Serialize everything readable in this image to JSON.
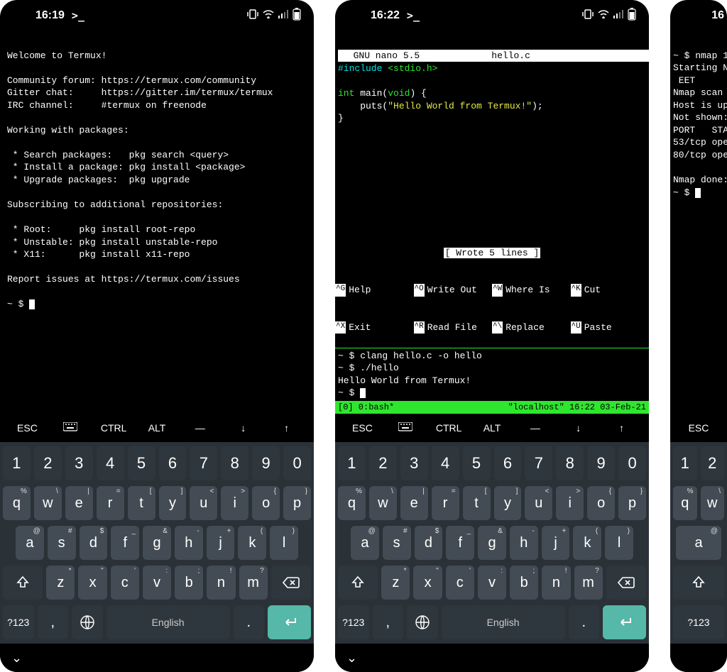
{
  "status": {
    "t1": "16:19",
    "t2": "16:22",
    "t3": "16",
    "prompt": ">_"
  },
  "p1": {
    "welcome": "Welcome to Termux!",
    "forum_label": "Community forum:",
    "forum_url": "https://termux.com/community",
    "gitter_label": "Gitter chat:",
    "gitter_url": "https://gitter.im/termux/termux",
    "irc_label": "IRC channel:",
    "irc_val": "#termux on freenode",
    "pkg_header": "Working with packages:",
    "pkg_search": " * Search packages:   pkg search <query>",
    "pkg_install": " * Install a package: pkg install <package>",
    "pkg_upgrade": " * Upgrade packages:  pkg upgrade",
    "repos_header": "Subscribing to additional repositories:",
    "repo_root": " * Root:     pkg install root-repo",
    "repo_unstable": " * Unstable: pkg install unstable-repo",
    "repo_x11": " * X11:      pkg install x11-repo",
    "issues": "Report issues at https://termux.com/issues",
    "prompt": "~ $ "
  },
  "p2": {
    "nano": {
      "title": "  GNU nano 5.5",
      "file": "hello.c",
      "include_pre": "#include ",
      "include_hdr": "<stdio.h>",
      "int": "int",
      "main": " main(",
      "void": "void",
      "main2": ") {",
      "puts_pre": "    puts(",
      "puts_str": "\"Hello World from Termux!\"",
      "puts_post": ");",
      "brace": "}",
      "wrote": "[ Wrote 5 lines ]",
      "help": [
        {
          "k": "^G",
          "t": "Help"
        },
        {
          "k": "^O",
          "t": "Write Out"
        },
        {
          "k": "^W",
          "t": "Where Is"
        },
        {
          "k": "^K",
          "t": "Cut"
        },
        {
          "k": "^X",
          "t": "Exit"
        },
        {
          "k": "^R",
          "t": "Read File"
        },
        {
          "k": "^\\",
          "t": "Replace"
        },
        {
          "k": "^U",
          "t": "Paste"
        }
      ]
    },
    "shell": {
      "l1": "~ $ clang hello.c -o hello",
      "l2": "~ $ ./hello",
      "l3": "Hello World from Termux!",
      "l4": "~ $ "
    },
    "tmux": {
      "left": "[0] 0:bash*",
      "host": "\"localhost\"",
      "right": " 16:22 03-Feb-21"
    }
  },
  "p3": {
    "l1": "~ $ nmap 1",
    "l2": "Starting N",
    "l3": " EET",
    "l4": "Nmap scan ",
    "l5": "Host is up",
    "l6": "Not shown:",
    "l7": "PORT   STA",
    "l8": "53/tcp ope",
    "l9": "80/tcp ope",
    "l10": "",
    "l11": "Nmap done:",
    "l12": "~ $ "
  },
  "toolbar": {
    "esc": "ESC",
    "kb": "⌨",
    "ctrl": "CTRL",
    "alt": "ALT",
    "dash": "—",
    "down": "↓",
    "up": "↑"
  },
  "keyboard": {
    "nums": [
      "1",
      "2",
      "3",
      "4",
      "5",
      "6",
      "7",
      "8",
      "9",
      "0"
    ],
    "row1": [
      "q",
      "w",
      "e",
      "r",
      "t",
      "y",
      "u",
      "i",
      "o",
      "p"
    ],
    "row1_sup": [
      "%",
      "\\",
      "|",
      "=",
      "[",
      "]",
      "<",
      ">",
      "{",
      "}"
    ],
    "row2": [
      "a",
      "s",
      "d",
      "f",
      "g",
      "h",
      "j",
      "k",
      "l"
    ],
    "row2_sup": [
      "@",
      "#",
      "$",
      "_",
      "&",
      "-",
      "+",
      "(",
      ")"
    ],
    "row3": [
      "z",
      "x",
      "c",
      "v",
      "b",
      "n",
      "m"
    ],
    "row3_sup": [
      "*",
      "\"",
      "'",
      ":",
      ";",
      "!",
      "?"
    ],
    "lang": "English",
    "sym": "?123",
    "comma": ",",
    "dot": "."
  }
}
